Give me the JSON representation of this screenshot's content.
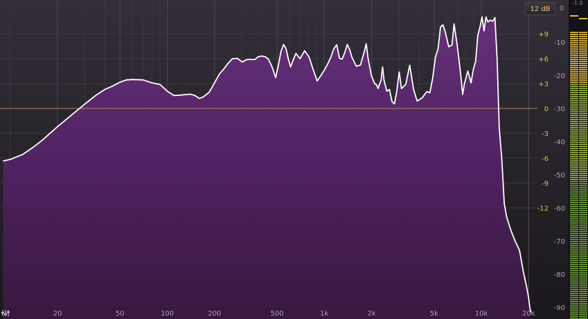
{
  "toolbar": {
    "range_label": "12 dB",
    "zero_label": "0",
    "peak_label": "-1.0"
  },
  "chart_data": {
    "type": "area",
    "x_axis": {
      "scale": "log",
      "range_hz": [
        9,
        20600
      ],
      "tick_labels": [
        "20",
        "50",
        "100",
        "200",
        "500",
        "1k",
        "2k",
        "5k",
        "10k",
        "20k"
      ],
      "tick_values_hz": [
        20,
        50,
        100,
        200,
        500,
        1000,
        2000,
        5000,
        10000,
        20000
      ]
    },
    "eq_axis": {
      "tick_labels": [
        "+9",
        "+6",
        "+3",
        "0",
        "-3",
        "-6",
        "-9",
        "-12"
      ],
      "tick_values_db": [
        9,
        6,
        3,
        0,
        -3,
        -6,
        -9,
        -12
      ]
    },
    "level_axis": {
      "tick_labels": [
        "-10",
        "-20",
        "-30",
        "-40",
        "-50",
        "-60",
        "-70",
        "-80",
        "-90"
      ],
      "tick_values_db": [
        -10,
        -20,
        -30,
        -40,
        -50,
        -60,
        -70,
        -80,
        -90
      ]
    },
    "series": [
      {
        "x_hz": [
          9,
          10,
          12,
          14,
          16,
          20,
          25,
          30,
          35,
          40,
          45,
          50,
          55,
          60,
          70,
          80,
          90,
          100,
          110,
          120,
          140,
          150,
          160,
          170,
          185,
          200,
          215,
          230,
          245,
          260,
          280,
          300,
          320,
          340,
          360,
          380,
          400,
          420,
          440,
          460,
          470,
          490,
          510,
          530,
          550,
          570,
          590,
          610,
          630,
          660,
          700,
          750,
          800,
          850,
          900,
          950,
          1000,
          1050,
          1100,
          1150,
          1200,
          1250,
          1300,
          1350,
          1400,
          1450,
          1500,
          1600,
          1700,
          1800,
          1850,
          1900,
          2000,
          2100,
          2150,
          2200,
          2300,
          2350,
          2400,
          2500,
          2600,
          2700,
          2800,
          2900,
          3000,
          3100,
          3300,
          3500,
          3700,
          3900,
          4200,
          4500,
          4700,
          4900,
          5100,
          5300,
          5500,
          5700,
          5900,
          6200,
          6500,
          6700,
          7000,
          7200,
          7400,
          7600,
          7800,
          8200,
          8600,
          8900,
          9200,
          9500,
          9800,
          10100,
          10400,
          10700,
          11000,
          11400,
          11800,
          12200,
          12600,
          13000,
          13500,
          14000,
          14500,
          15500,
          16500,
          17500,
          18500,
          19500,
          20000,
          20300,
          20600
        ],
        "level_db": [
          -45.9,
          -45.4,
          -43.9,
          -41.7,
          -39.6,
          -35.5,
          -31.7,
          -28.6,
          -26.1,
          -24.3,
          -23.2,
          -22.1,
          -21.4,
          -21.3,
          -21.4,
          -22.3,
          -22.8,
          -24.8,
          -26.1,
          -26.0,
          -25.7,
          -26.1,
          -27.0,
          -26.5,
          -25.1,
          -22.3,
          -19.6,
          -18.0,
          -16.3,
          -15.0,
          -14.9,
          -16.0,
          -15.3,
          -15.2,
          -15.3,
          -14.4,
          -14.2,
          -14.4,
          -15.1,
          -17.0,
          -18.1,
          -20.7,
          -17.0,
          -12.8,
          -10.7,
          -11.9,
          -15.1,
          -17.5,
          -15.7,
          -13.4,
          -15.0,
          -12.6,
          -14.5,
          -18.3,
          -21.7,
          -20.1,
          -18.5,
          -16.6,
          -14.6,
          -12.0,
          -10.8,
          -14.9,
          -15.1,
          -13.2,
          -10.7,
          -12.2,
          -14.6,
          -17.3,
          -16.9,
          -12.8,
          -10.5,
          -15.0,
          -20.3,
          -22.6,
          -22.8,
          -24.0,
          -21.4,
          -17.5,
          -21.5,
          -24.8,
          -24.3,
          -28.0,
          -28.6,
          -24.5,
          -19.0,
          -24.0,
          -22.8,
          -17.0,
          -24.2,
          -27.8,
          -26.8,
          -24.9,
          -25.3,
          -20.8,
          -14.5,
          -12.0,
          -5.4,
          -4.8,
          -7.0,
          -11.4,
          -10.9,
          -4.5,
          -10.6,
          -15.1,
          -20.0,
          -25.8,
          -22.6,
          -18.7,
          -22.3,
          -18.2,
          -15.7,
          -7.9,
          -5.5,
          -2.4,
          -6.6,
          -2.4,
          -3.9,
          -3.4,
          -3.7,
          -2.6,
          -15.2,
          -35.6,
          -45.5,
          -58.7,
          -62.8,
          -67.1,
          -70.3,
          -72.8,
          -79.2,
          -84.3,
          -87.2,
          -89.6,
          -91.6,
          -93.0,
          -95.0,
          -98.0,
          -100.0
        ]
      }
    ],
    "reference_line_db": 0,
    "meter": {
      "peak_label": "-1.0"
    }
  },
  "colors": {
    "background": "#1c1a1f",
    "fill_top": "#5c2a6e",
    "fill_bottom": "#3a1a46",
    "curve": "#ffffff",
    "zero_line": "#c89a5a",
    "eq_label": "#e8c040",
    "level_label": "#a8a2ac",
    "meter_green": "#6fa03a",
    "meter_yellow": "#e8c040"
  }
}
